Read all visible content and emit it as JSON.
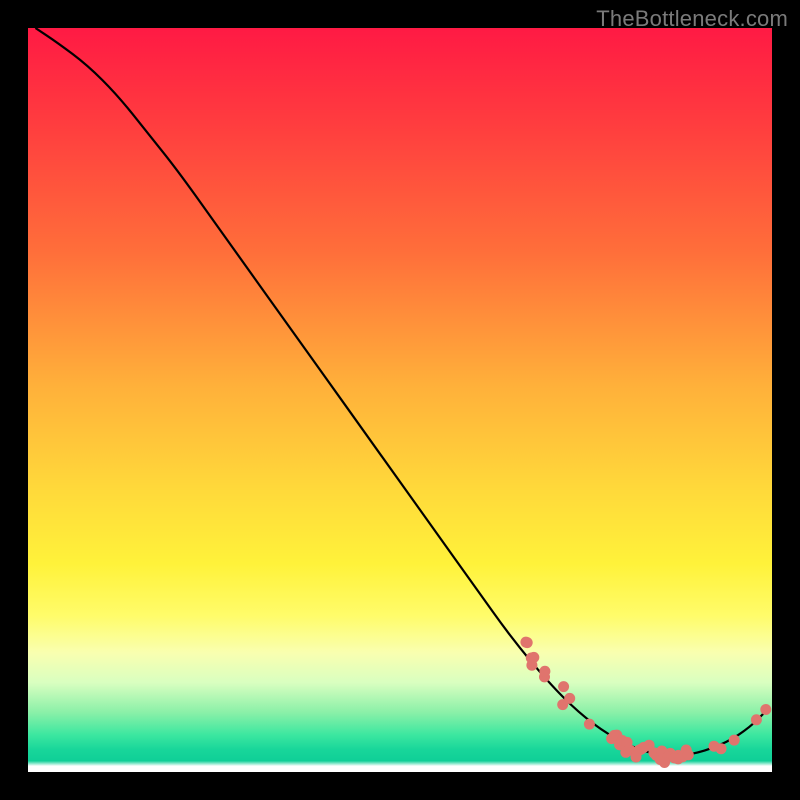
{
  "watermark": "TheBottleneck.com",
  "colors": {
    "dot": "#e0746d",
    "line": "#000000"
  },
  "chart_data": {
    "type": "line",
    "title": "",
    "xlabel": "",
    "ylabel": "",
    "xlim": [
      0,
      100
    ],
    "ylim": [
      0,
      100
    ],
    "grid": false,
    "legend": false,
    "curve": [
      {
        "x": 1,
        "y": 100
      },
      {
        "x": 4,
        "y": 98
      },
      {
        "x": 8,
        "y": 95
      },
      {
        "x": 12,
        "y": 91
      },
      {
        "x": 16,
        "y": 86
      },
      {
        "x": 20,
        "y": 81
      },
      {
        "x": 25,
        "y": 74
      },
      {
        "x": 30,
        "y": 67
      },
      {
        "x": 35,
        "y": 60
      },
      {
        "x": 40,
        "y": 53
      },
      {
        "x": 45,
        "y": 46
      },
      {
        "x": 50,
        "y": 39
      },
      {
        "x": 55,
        "y": 32
      },
      {
        "x": 60,
        "y": 25
      },
      {
        "x": 65,
        "y": 18
      },
      {
        "x": 70,
        "y": 12
      },
      {
        "x": 74,
        "y": 8
      },
      {
        "x": 78,
        "y": 5
      },
      {
        "x": 82,
        "y": 3
      },
      {
        "x": 86,
        "y": 2
      },
      {
        "x": 90,
        "y": 2.5
      },
      {
        "x": 94,
        "y": 4
      },
      {
        "x": 97,
        "y": 6
      },
      {
        "x": 99,
        "y": 8
      }
    ],
    "dot_clusters": [
      {
        "x": 66,
        "y": 17,
        "spread": 1.2,
        "n": 2
      },
      {
        "x": 67.5,
        "y": 15,
        "spread": 1.2,
        "n": 3
      },
      {
        "x": 69,
        "y": 13,
        "spread": 1.0,
        "n": 2
      },
      {
        "x": 71,
        "y": 11,
        "spread": 1.0,
        "n": 1
      },
      {
        "x": 72.5,
        "y": 9.5,
        "spread": 1.0,
        "n": 2
      },
      {
        "x": 76,
        "y": 6.5,
        "spread": 0.8,
        "n": 1
      },
      {
        "x": 79,
        "y": 4.5,
        "spread": 1.5,
        "n": 4
      },
      {
        "x": 81,
        "y": 3.5,
        "spread": 1.5,
        "n": 5
      },
      {
        "x": 83,
        "y": 2.8,
        "spread": 1.5,
        "n": 6
      },
      {
        "x": 85,
        "y": 2.3,
        "spread": 1.5,
        "n": 6
      },
      {
        "x": 87,
        "y": 2.1,
        "spread": 1.5,
        "n": 5
      },
      {
        "x": 89,
        "y": 2.3,
        "spread": 1.2,
        "n": 3
      },
      {
        "x": 93,
        "y": 3.5,
        "spread": 1.0,
        "n": 2
      },
      {
        "x": 94.5,
        "y": 4.5,
        "spread": 0.8,
        "n": 1
      },
      {
        "x": 98,
        "y": 7,
        "spread": 0.6,
        "n": 1
      },
      {
        "x": 99.2,
        "y": 8.2,
        "spread": 0.5,
        "n": 1
      }
    ]
  }
}
